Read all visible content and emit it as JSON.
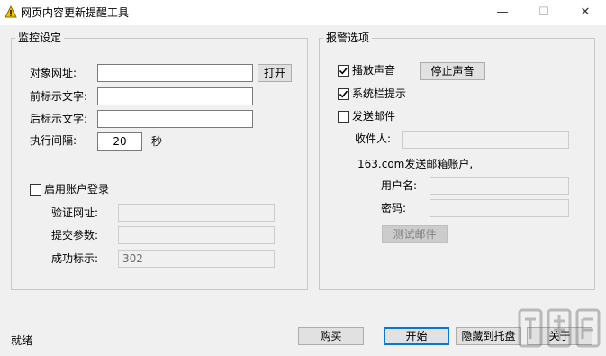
{
  "window": {
    "title": "网页内容更新提醒工具",
    "minimize": "—",
    "maximize": "☐",
    "close": "✕"
  },
  "monitor": {
    "legend": "监控设定",
    "target_url_label": "对象网址:",
    "target_url_value": "",
    "open_button": "打开",
    "prefix_label": "前标示文字:",
    "prefix_value": "",
    "suffix_label": "后标示文字:",
    "suffix_value": "",
    "interval_label": "执行间隔:",
    "interval_value": "20",
    "interval_unit": "秒",
    "login_checkbox_label": "启用账户登录",
    "login_checked": false,
    "verify_url_label": "验证网址:",
    "verify_url_value": "",
    "submit_params_label": "提交参数:",
    "submit_params_value": "",
    "success_label": "成功标示:",
    "success_value": "302"
  },
  "alarm": {
    "legend": "报警选项",
    "play_sound_label": "播放声音",
    "play_sound_checked": true,
    "stop_sound_button": "停止声音",
    "tray_tip_label": "系统栏提示",
    "tray_tip_checked": true,
    "send_mail_label": "发送邮件",
    "send_mail_checked": false,
    "recipient_label": "收件人:",
    "recipient_value": "",
    "sender_note": "163.com发送邮箱账户,",
    "username_label": "用户名:",
    "username_value": "",
    "password_label": "密码:",
    "password_value": "",
    "test_mail_button": "测试邮件"
  },
  "footer": {
    "status": "就绪",
    "buy_button": "购买",
    "start_button": "开始",
    "hide_tray_button": "隐藏到托盘",
    "about_button": "关于"
  },
  "watermark": {
    "text": "下载吧"
  },
  "colors": {
    "accent": "#0078d7",
    "window_bg": "#f0f0f0",
    "titlebar_bg": "#ffffff"
  }
}
